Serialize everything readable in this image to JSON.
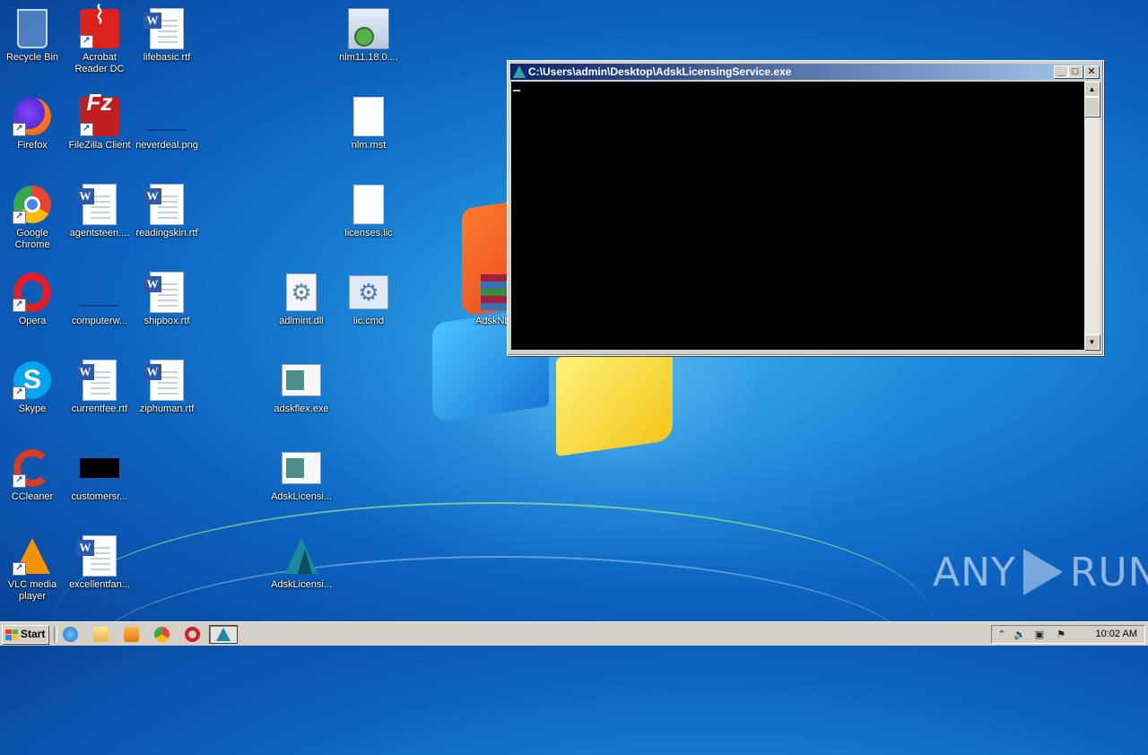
{
  "desktop": {
    "icons": [
      {
        "label": "Recycle Bin",
        "icon": "recycle-bin-icon"
      },
      {
        "label": "Acrobat Reader DC",
        "icon": "acrobat-reader-icon"
      },
      {
        "label": "lifebasic.rtf",
        "icon": "word-document-icon"
      },
      {
        "label": "nlm11.18.0....",
        "icon": "installer-icon"
      },
      {
        "label": "Firefox",
        "icon": "firefox-icon"
      },
      {
        "label": "FileZilla Client",
        "icon": "filezilla-icon"
      },
      {
        "label": "neverdeal.png",
        "icon": "image-file-icon"
      },
      {
        "label": "nlm.mst",
        "icon": "blank-file-icon"
      },
      {
        "label": "Google Chrome",
        "icon": "chrome-icon"
      },
      {
        "label": "agentsteen....",
        "icon": "word-document-icon"
      },
      {
        "label": "readingskin.rtf",
        "icon": "word-document-icon"
      },
      {
        "label": "licenses.lic",
        "icon": "blank-file-icon"
      },
      {
        "label": "Opera",
        "icon": "opera-icon"
      },
      {
        "label": "computerw...",
        "icon": "image-file-icon"
      },
      {
        "label": "shipbox.rtf",
        "icon": "word-document-icon"
      },
      {
        "label": "adlmint.dll",
        "icon": "dll-file-icon"
      },
      {
        "label": "lic.cmd",
        "icon": "cmd-file-icon"
      },
      {
        "label": "AdskNL",
        "icon": "archive-icon"
      },
      {
        "label": "Skype",
        "icon": "skype-icon"
      },
      {
        "label": "currentfee.rtf",
        "icon": "word-document-icon"
      },
      {
        "label": "ziphuman.rtf",
        "icon": "word-document-icon"
      },
      {
        "label": "adskflex.exe",
        "icon": "exe-file-icon"
      },
      {
        "label": "CCleaner",
        "icon": "ccleaner-icon"
      },
      {
        "label": "customersr...",
        "icon": "image-file-icon"
      },
      {
        "label": "AdskLicensi...",
        "icon": "exe-file-icon"
      },
      {
        "label": "VLC media player",
        "icon": "vlc-icon"
      },
      {
        "label": "excellentfan...",
        "icon": "word-document-icon"
      },
      {
        "label": "AdskLicensi...",
        "icon": "autodesk-icon"
      }
    ]
  },
  "console_window": {
    "title": "C:\\Users\\admin\\Desktop\\AdskLicensingService.exe",
    "minimize": "_",
    "maximize": "□",
    "close": "✕",
    "background": "#000000"
  },
  "watermark": {
    "left": "ANY",
    "right": "RUN"
  },
  "taskbar": {
    "start_label": "Start",
    "clock": "10:02 AM"
  }
}
